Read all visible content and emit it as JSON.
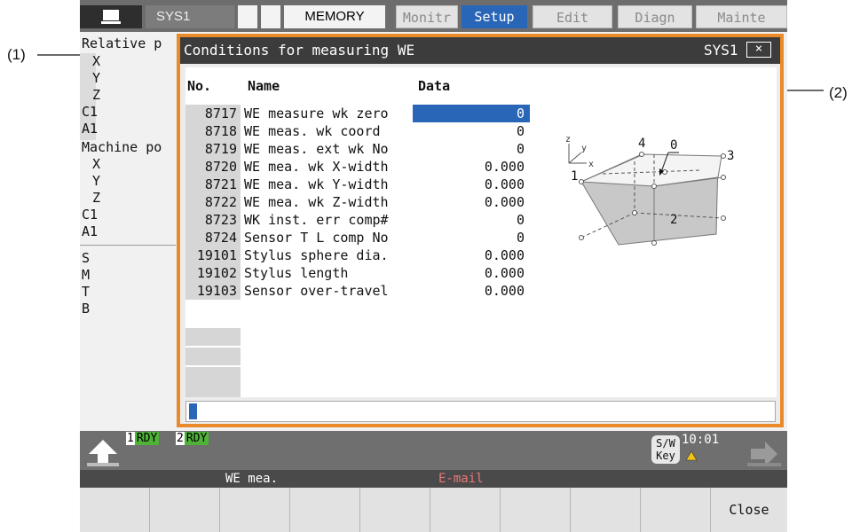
{
  "callouts": {
    "c1": "(1)",
    "c2": "(2)"
  },
  "topbar": {
    "system": "SYS1",
    "mode": "MEMORY",
    "tabs": [
      "Monitr",
      "Setup",
      "Edit",
      "Diagn",
      "Mainte"
    ],
    "active_tab": "Setup"
  },
  "background": {
    "relative_label": "Relative p",
    "relative_axes": [
      "X",
      "Y",
      "Z",
      "C1",
      "A1"
    ],
    "machine_label": "Machine po",
    "machine_axes": [
      "X",
      "Y",
      "Z",
      "C1",
      "A1"
    ],
    "codes": [
      "S",
      "M",
      "T",
      "B"
    ]
  },
  "dialog": {
    "title": "Conditions for measuring WE",
    "system": "SYS1",
    "close_glyph": "×",
    "columns": {
      "no": "No.",
      "name": "Name",
      "data": "Data"
    },
    "rows": [
      {
        "no": "8717",
        "name": "WE measure wk zero",
        "data": "0",
        "selected": true
      },
      {
        "no": "8718",
        "name": "WE meas. wk coord",
        "data": "0"
      },
      {
        "no": "8719",
        "name": "WE meas. ext wk No",
        "data": "0"
      },
      {
        "no": "8720",
        "name": "WE mea. wk X-width",
        "data": "0.000"
      },
      {
        "no": "8721",
        "name": "WE mea. wk Y-width",
        "data": "0.000"
      },
      {
        "no": "8722",
        "name": "WE mea. wk Z-width",
        "data": "0.000"
      },
      {
        "no": "8723",
        "name": "WK inst. err comp#",
        "data": "0"
      },
      {
        "no": "8724",
        "name": "Sensor T L comp No",
        "data": "0"
      },
      {
        "no": "19101",
        "name": "Stylus sphere dia.",
        "data": "0.000"
      },
      {
        "no": "19102",
        "name": "Stylus length",
        "data": "0.000"
      },
      {
        "no": "19103",
        "name": "Sensor over-travel",
        "data": "0.000"
      }
    ],
    "diagram": {
      "axes": [
        "z",
        "y",
        "x"
      ],
      "labels": [
        "1",
        "2",
        "3",
        "4",
        "0"
      ]
    },
    "input_value": ""
  },
  "status": {
    "rdy1_num": "1",
    "rdy1": "RDY",
    "rdy2_num": "2",
    "rdy2": "RDY",
    "swkey": [
      "S/W",
      "Key"
    ],
    "time": "10:01"
  },
  "menu_labels": {
    "left": "WE mea.",
    "right": "E-mail"
  },
  "softkeys": [
    "",
    "",
    "",
    "",
    "",
    "",
    "",
    "",
    "",
    "Close"
  ]
}
